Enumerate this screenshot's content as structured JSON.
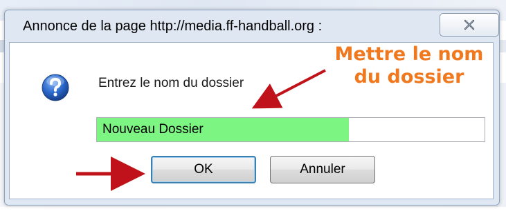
{
  "window": {
    "title": "Annonce de la page http://media.ff-handball.org :",
    "close_icon": "close-icon"
  },
  "dialog": {
    "icon": "question-icon",
    "prompt": "Entrez le nom du dossier",
    "input_value": "Nouveau Dossier",
    "ok_label": "OK",
    "cancel_label": "Annuler"
  },
  "annotation": {
    "line1": "Mettre le nom",
    "line2": "du dossier",
    "color": "#f0781e",
    "arrow_color": "#c0121a"
  },
  "colors": {
    "input_highlight": "#7cf582",
    "icon_blue": "#2a66c9"
  }
}
